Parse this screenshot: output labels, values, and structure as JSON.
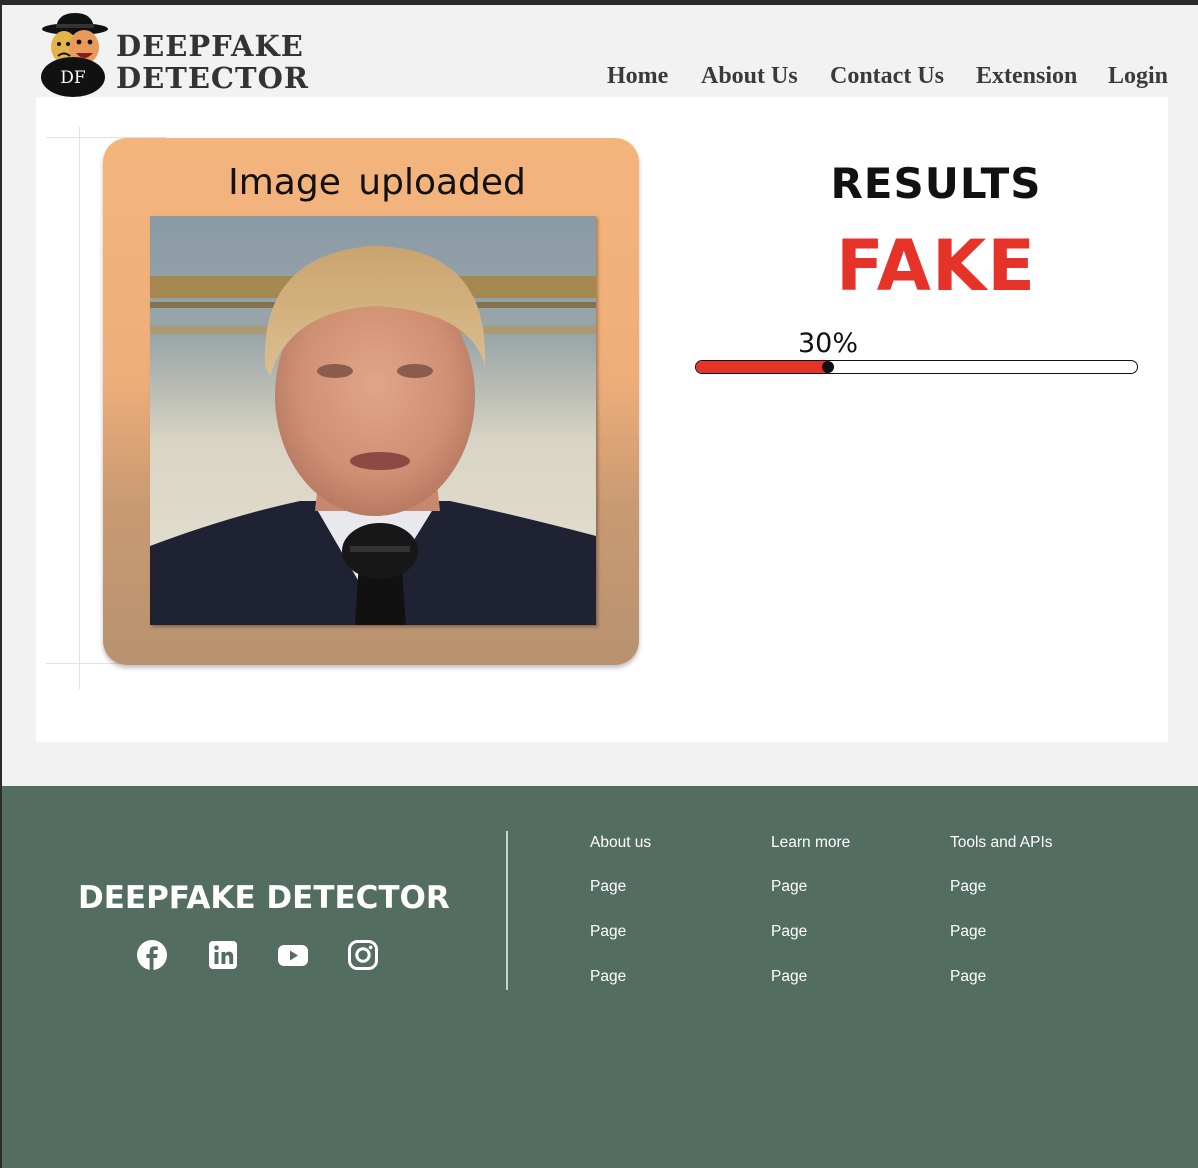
{
  "header": {
    "brand_line1": "DEEPFAKE",
    "brand_line2": "DETECTOR",
    "logo_text": "DF",
    "nav": [
      "Home",
      "About Us",
      "Contact Us",
      "Extension",
      "Login"
    ]
  },
  "upload": {
    "title": "Image  uploaded",
    "image_alt": "uploaded-photo"
  },
  "results": {
    "title": "RESULTS",
    "verdict": "FAKE",
    "score_label": "30%",
    "score_value": 0.3
  },
  "footer": {
    "brand": "DEEPFAKE DETECTOR",
    "social": [
      "facebook-icon",
      "linkedin-icon",
      "youtube-icon",
      "instagram-icon"
    ],
    "columns": [
      {
        "heading": "About us",
        "links": [
          "Page",
          "Page",
          "Page"
        ]
      },
      {
        "heading": "Learn more",
        "links": [
          "Page",
          "Page",
          "Page"
        ]
      },
      {
        "heading": "Tools and APIs",
        "links": [
          "Page",
          "Page",
          "Page"
        ]
      }
    ]
  },
  "colors": {
    "verdict": "#e63329",
    "footer_bg": "#536d61",
    "panel": "#f3b57c"
  }
}
